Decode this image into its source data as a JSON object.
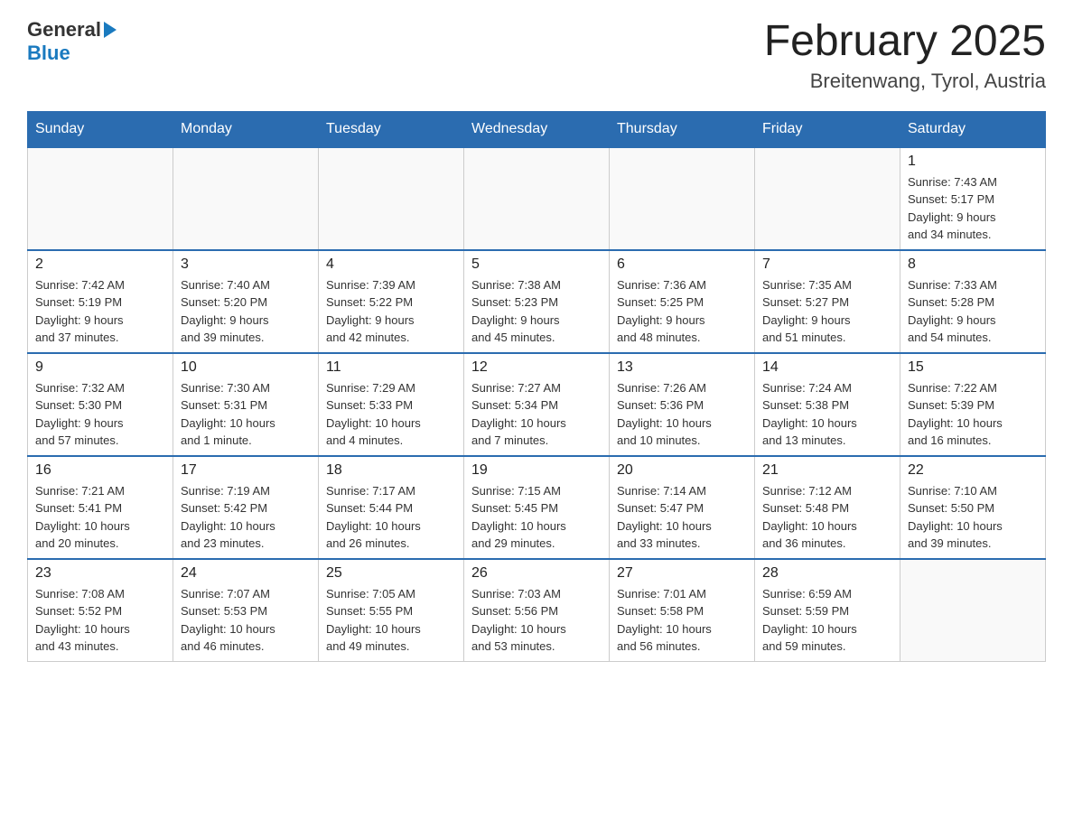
{
  "header": {
    "logo_general": "General",
    "logo_blue": "Blue",
    "title": "February 2025",
    "subtitle": "Breitenwang, Tyrol, Austria"
  },
  "days_of_week": [
    "Sunday",
    "Monday",
    "Tuesday",
    "Wednesday",
    "Thursday",
    "Friday",
    "Saturday"
  ],
  "weeks": [
    {
      "days": [
        {
          "num": "",
          "info": ""
        },
        {
          "num": "",
          "info": ""
        },
        {
          "num": "",
          "info": ""
        },
        {
          "num": "",
          "info": ""
        },
        {
          "num": "",
          "info": ""
        },
        {
          "num": "",
          "info": ""
        },
        {
          "num": "1",
          "info": "Sunrise: 7:43 AM\nSunset: 5:17 PM\nDaylight: 9 hours\nand 34 minutes."
        }
      ]
    },
    {
      "days": [
        {
          "num": "2",
          "info": "Sunrise: 7:42 AM\nSunset: 5:19 PM\nDaylight: 9 hours\nand 37 minutes."
        },
        {
          "num": "3",
          "info": "Sunrise: 7:40 AM\nSunset: 5:20 PM\nDaylight: 9 hours\nand 39 minutes."
        },
        {
          "num": "4",
          "info": "Sunrise: 7:39 AM\nSunset: 5:22 PM\nDaylight: 9 hours\nand 42 minutes."
        },
        {
          "num": "5",
          "info": "Sunrise: 7:38 AM\nSunset: 5:23 PM\nDaylight: 9 hours\nand 45 minutes."
        },
        {
          "num": "6",
          "info": "Sunrise: 7:36 AM\nSunset: 5:25 PM\nDaylight: 9 hours\nand 48 minutes."
        },
        {
          "num": "7",
          "info": "Sunrise: 7:35 AM\nSunset: 5:27 PM\nDaylight: 9 hours\nand 51 minutes."
        },
        {
          "num": "8",
          "info": "Sunrise: 7:33 AM\nSunset: 5:28 PM\nDaylight: 9 hours\nand 54 minutes."
        }
      ]
    },
    {
      "days": [
        {
          "num": "9",
          "info": "Sunrise: 7:32 AM\nSunset: 5:30 PM\nDaylight: 9 hours\nand 57 minutes."
        },
        {
          "num": "10",
          "info": "Sunrise: 7:30 AM\nSunset: 5:31 PM\nDaylight: 10 hours\nand 1 minute."
        },
        {
          "num": "11",
          "info": "Sunrise: 7:29 AM\nSunset: 5:33 PM\nDaylight: 10 hours\nand 4 minutes."
        },
        {
          "num": "12",
          "info": "Sunrise: 7:27 AM\nSunset: 5:34 PM\nDaylight: 10 hours\nand 7 minutes."
        },
        {
          "num": "13",
          "info": "Sunrise: 7:26 AM\nSunset: 5:36 PM\nDaylight: 10 hours\nand 10 minutes."
        },
        {
          "num": "14",
          "info": "Sunrise: 7:24 AM\nSunset: 5:38 PM\nDaylight: 10 hours\nand 13 minutes."
        },
        {
          "num": "15",
          "info": "Sunrise: 7:22 AM\nSunset: 5:39 PM\nDaylight: 10 hours\nand 16 minutes."
        }
      ]
    },
    {
      "days": [
        {
          "num": "16",
          "info": "Sunrise: 7:21 AM\nSunset: 5:41 PM\nDaylight: 10 hours\nand 20 minutes."
        },
        {
          "num": "17",
          "info": "Sunrise: 7:19 AM\nSunset: 5:42 PM\nDaylight: 10 hours\nand 23 minutes."
        },
        {
          "num": "18",
          "info": "Sunrise: 7:17 AM\nSunset: 5:44 PM\nDaylight: 10 hours\nand 26 minutes."
        },
        {
          "num": "19",
          "info": "Sunrise: 7:15 AM\nSunset: 5:45 PM\nDaylight: 10 hours\nand 29 minutes."
        },
        {
          "num": "20",
          "info": "Sunrise: 7:14 AM\nSunset: 5:47 PM\nDaylight: 10 hours\nand 33 minutes."
        },
        {
          "num": "21",
          "info": "Sunrise: 7:12 AM\nSunset: 5:48 PM\nDaylight: 10 hours\nand 36 minutes."
        },
        {
          "num": "22",
          "info": "Sunrise: 7:10 AM\nSunset: 5:50 PM\nDaylight: 10 hours\nand 39 minutes."
        }
      ]
    },
    {
      "days": [
        {
          "num": "23",
          "info": "Sunrise: 7:08 AM\nSunset: 5:52 PM\nDaylight: 10 hours\nand 43 minutes."
        },
        {
          "num": "24",
          "info": "Sunrise: 7:07 AM\nSunset: 5:53 PM\nDaylight: 10 hours\nand 46 minutes."
        },
        {
          "num": "25",
          "info": "Sunrise: 7:05 AM\nSunset: 5:55 PM\nDaylight: 10 hours\nand 49 minutes."
        },
        {
          "num": "26",
          "info": "Sunrise: 7:03 AM\nSunset: 5:56 PM\nDaylight: 10 hours\nand 53 minutes."
        },
        {
          "num": "27",
          "info": "Sunrise: 7:01 AM\nSunset: 5:58 PM\nDaylight: 10 hours\nand 56 minutes."
        },
        {
          "num": "28",
          "info": "Sunrise: 6:59 AM\nSunset: 5:59 PM\nDaylight: 10 hours\nand 59 minutes."
        },
        {
          "num": "",
          "info": ""
        }
      ]
    }
  ]
}
